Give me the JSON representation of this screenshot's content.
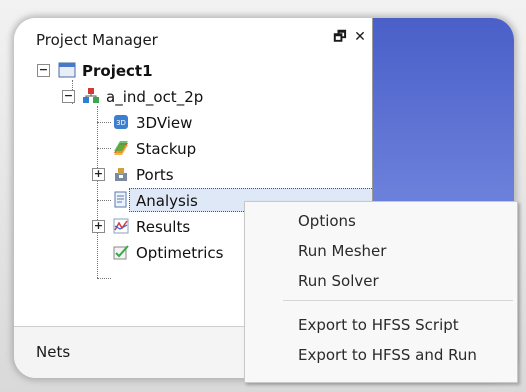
{
  "panel": {
    "title": "Project Manager",
    "float_glyph": "🗗",
    "close_glyph": "✕"
  },
  "tree": {
    "project": "Project1",
    "design": "a_ind_oct_2p",
    "children": [
      {
        "label": "3DView",
        "icon": "3dview-icon"
      },
      {
        "label": "Stackup",
        "icon": "stackup-icon"
      },
      {
        "label": "Ports",
        "icon": "ports-icon"
      },
      {
        "label": "Analysis",
        "icon": "analysis-icon"
      },
      {
        "label": "Results",
        "icon": "results-icon"
      },
      {
        "label": "Optimetrics",
        "icon": "optimetrics-icon"
      }
    ],
    "expander_plus": "+",
    "expander_minus": "−"
  },
  "bottom_tab": {
    "label": "Nets"
  },
  "context_menu": {
    "items": [
      {
        "label": "Options"
      },
      {
        "label": "Run Mesher"
      },
      {
        "label": "Run Solver"
      },
      {
        "label": "Export to HFSS Script"
      },
      {
        "label": "Export to HFSS and Run"
      }
    ]
  },
  "colors": {
    "viewport_top": "#4a5fc8",
    "viewport_bottom": "#8ea0e6",
    "selection": "#dfe8f6"
  }
}
